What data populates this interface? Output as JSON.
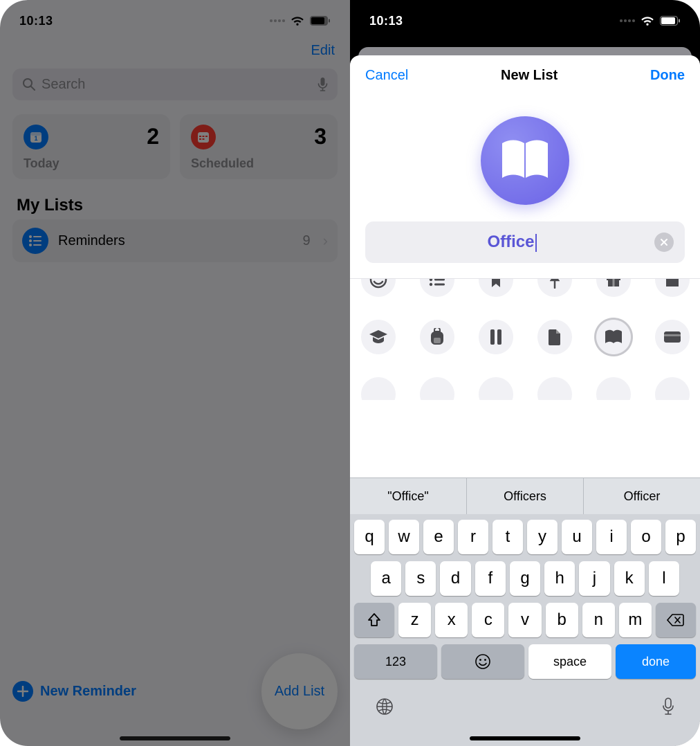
{
  "left": {
    "status_time": "10:13",
    "edit_btn": "Edit",
    "search_placeholder": "Search",
    "cards": [
      {
        "label": "Today",
        "count": "2",
        "color": "blue"
      },
      {
        "label": "Scheduled",
        "count": "3",
        "color": "red"
      }
    ],
    "section_title": "My Lists",
    "lists": [
      {
        "name": "Reminders",
        "count": "9"
      }
    ],
    "new_reminder_label": "New Reminder",
    "add_list_label": "Add List"
  },
  "right": {
    "status_time": "10:13",
    "sheet": {
      "cancel": "Cancel",
      "title": "New List",
      "done": "Done",
      "name_value": "Office",
      "icon_color": "#6b63e6",
      "selected_icon": "book-open-icon",
      "icon_palette": [
        "smiley-icon",
        "list-icon",
        "bookmark-icon",
        "pin-icon",
        "gift-icon",
        "storefront-icon",
        "graduation-icon",
        "backpack-icon",
        "pen-ruler-icon",
        "document-icon",
        "book-open-icon",
        "card-icon",
        "photo-icon",
        "camera-icon",
        "utensils-icon",
        "running-icon",
        "fork-knife-icon"
      ]
    },
    "keyboard": {
      "suggestions": [
        "\"Office\"",
        "Officers",
        "Officer"
      ],
      "rows": [
        [
          "q",
          "w",
          "e",
          "r",
          "t",
          "y",
          "u",
          "i",
          "o",
          "p"
        ],
        [
          "a",
          "s",
          "d",
          "f",
          "g",
          "h",
          "j",
          "k",
          "l"
        ],
        [
          "z",
          "x",
          "c",
          "v",
          "b",
          "n",
          "m"
        ]
      ],
      "switch_label": "123",
      "space_label": "space",
      "done_label": "done"
    }
  }
}
